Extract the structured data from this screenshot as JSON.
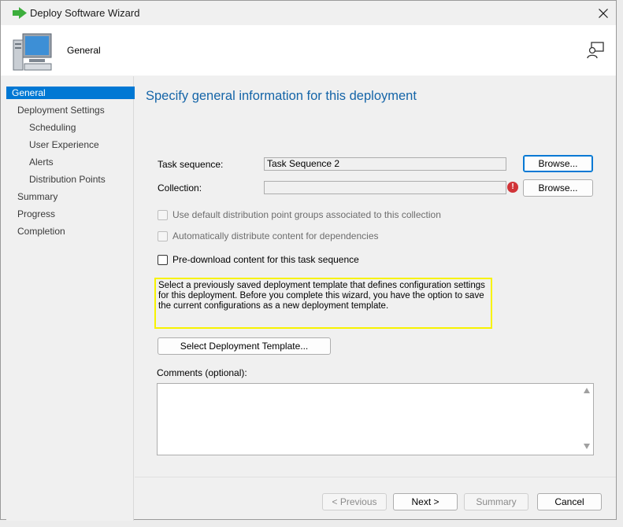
{
  "window": {
    "title": "Deploy Software Wizard",
    "close_glyph": "✕"
  },
  "header": {
    "title": "General",
    "image": "computer-icon",
    "right_icon": "user-search-icon"
  },
  "sidebar": {
    "items": [
      {
        "label": "General",
        "active": true
      },
      {
        "label": "Deployment Settings"
      },
      {
        "label": "Scheduling"
      },
      {
        "label": "User Experience"
      },
      {
        "label": "Alerts"
      },
      {
        "label": "Distribution Points"
      },
      {
        "label": "Summary"
      },
      {
        "label": "Progress"
      },
      {
        "label": "Completion"
      }
    ]
  },
  "main": {
    "title": "Specify general information for this deployment",
    "task_sequence": {
      "label": "Task sequence:",
      "value": "Task Sequence 2",
      "browse": "Browse..."
    },
    "collection": {
      "label": "Collection:",
      "value": "",
      "browse": "Browse...",
      "error_glyph": "!"
    },
    "options": {
      "use_default_dp": "Use default distribution point groups associated to this collection",
      "auto_distribute": "Automatically distribute content for dependencies",
      "pre_download": "Pre-download content for this task sequence"
    },
    "template_info": "Select a previously saved deployment template that defines configuration settings for this deployment. Before you complete this wizard, you have the option to save the current configurations as a new deployment template.",
    "select_template_button": "Select Deployment Template...",
    "comments": {
      "label": "Comments (optional):",
      "value": ""
    }
  },
  "footer": {
    "previous": "< Previous",
    "next": "Next >",
    "summary": "Summary",
    "cancel": "Cancel"
  },
  "colors": {
    "accent": "#0078d4",
    "title_blue": "#1565a8",
    "highlight": "#f7f300",
    "error": "#d13438"
  }
}
